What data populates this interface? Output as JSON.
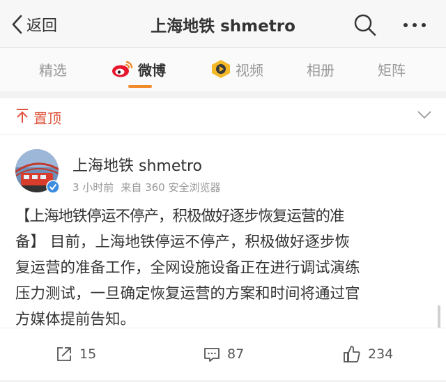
{
  "header": {
    "back_label": "返回",
    "title": "上海地铁 shmetro"
  },
  "tabs": [
    {
      "label": "精选",
      "active": false
    },
    {
      "label": "微博",
      "active": true
    },
    {
      "label": "视频",
      "active": false
    },
    {
      "label": "相册",
      "active": false
    },
    {
      "label": "矩阵",
      "active": false
    }
  ],
  "pinned": {
    "label": "置顶"
  },
  "post": {
    "author": "上海地铁 shmetro",
    "time": "3 小时前",
    "source": "来自 360 安全浏览器",
    "text_lines": [
      "【上海地铁停运不停产，积极做好逐步恢复运营的准",
      "备】 目前，上海地铁停运不停产，积极做好逐步恢",
      "复运营的准备工作，全网设施设备正在进行调试演练",
      "压力测试，一旦确定恢复运营的方案和时间将通过官",
      "方媒体提前告知。"
    ]
  },
  "actions": {
    "repost_count": "15",
    "comment_count": "87",
    "like_count": "234"
  },
  "colors": {
    "accent_orange": "#f18a2a",
    "pin_red": "#e0553e",
    "verified_blue": "#3b8de0"
  },
  "icons": [
    "back-chevron-icon",
    "search-icon",
    "more-dots-icon",
    "weibo-logo-icon",
    "video-icon",
    "pin-top-icon",
    "chevron-down-icon",
    "verified-badge-icon",
    "repost-icon",
    "comment-icon",
    "like-icon"
  ]
}
